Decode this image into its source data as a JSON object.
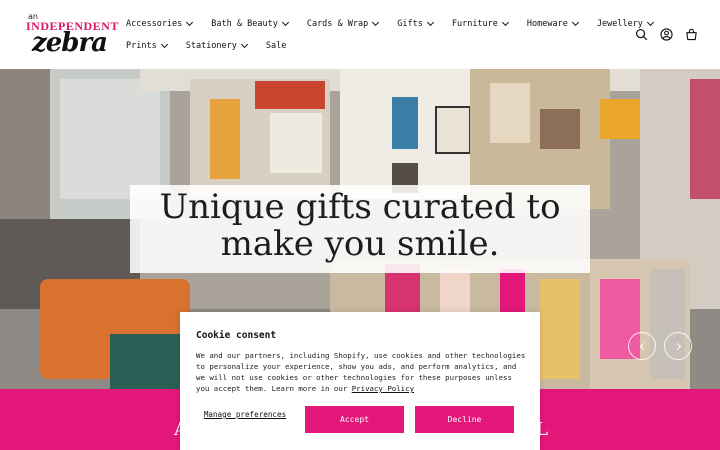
{
  "logo": {
    "line1": "an",
    "line2": "INDEPENDENT",
    "line3": "zebra"
  },
  "nav": {
    "row1": [
      {
        "label": "Accessories",
        "dropdown": true
      },
      {
        "label": "Bath & Beauty",
        "dropdown": true
      },
      {
        "label": "Cards & Wrap",
        "dropdown": true
      },
      {
        "label": "Gifts",
        "dropdown": true
      },
      {
        "label": "Furniture",
        "dropdown": true
      },
      {
        "label": "Homeware",
        "dropdown": true
      },
      {
        "label": "Jewellery",
        "dropdown": true
      }
    ],
    "row2": [
      {
        "label": "Prints",
        "dropdown": true
      },
      {
        "label": "Stationery",
        "dropdown": true
      },
      {
        "label": "Sale",
        "dropdown": false
      }
    ]
  },
  "header_icons": [
    "search-icon",
    "account-icon",
    "cart-icon"
  ],
  "hero": {
    "headline_line1": "Unique gifts curated to",
    "headline_line2": "make you smile."
  },
  "pink_band": {
    "left_fragment": "A",
    "right_fragment": "L"
  },
  "cookie": {
    "title": "Cookie consent",
    "body": "We and our partners, including Shopify, use cookies and other technologies to personalize your experience, show you ads, and perform analytics, and we will not use cookies or other technologies for these purposes unless you accept them. Learn more in our ",
    "link": "Privacy Policy",
    "manage": "Manage preferences",
    "accept": "Accept",
    "decline": "Decline"
  },
  "colors": {
    "brand_pink": "#e3177a",
    "text": "#111111",
    "background": "#ffffff"
  }
}
